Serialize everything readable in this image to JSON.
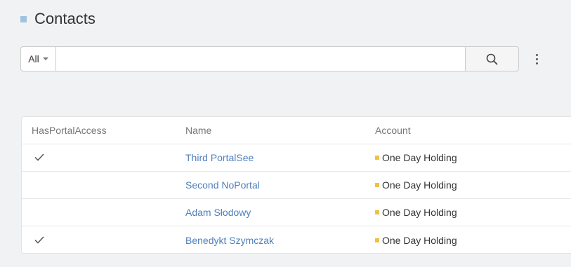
{
  "page": {
    "title": "Contacts"
  },
  "search": {
    "scope_label": "All",
    "value": "",
    "placeholder": ""
  },
  "table": {
    "headers": {
      "portal_access": "HasPortalAccess",
      "name": "Name",
      "account": "Account"
    },
    "rows": [
      {
        "portal_access": true,
        "name": "Third PortalSee",
        "account": "One Day Holding"
      },
      {
        "portal_access": false,
        "name": "Second NoPortal",
        "account": "One Day Holding"
      },
      {
        "portal_access": false,
        "name": "Adam Słodowy",
        "account": "One Day Holding"
      },
      {
        "portal_access": true,
        "name": "Benedykt Szymczak",
        "account": "One Day Holding"
      }
    ]
  },
  "colors": {
    "background": "#f1f2f4",
    "title_marker": "#9fc2e0",
    "link": "#4f7fbd",
    "account_marker": "#f0c040"
  },
  "icons": {
    "search": "search-icon",
    "more": "vertical-ellipsis-icon",
    "check": "check-icon"
  }
}
